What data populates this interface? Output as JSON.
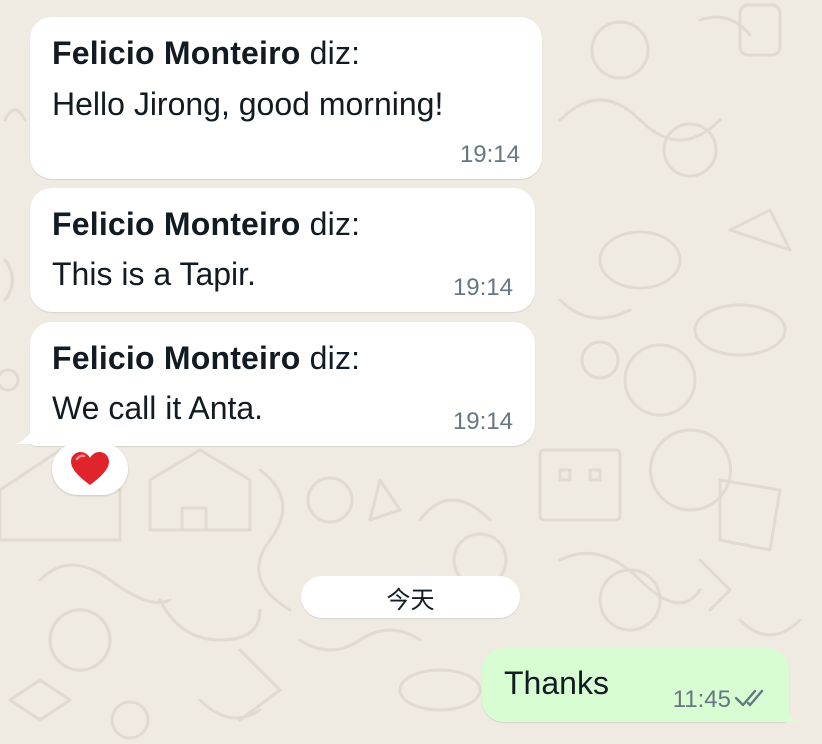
{
  "colors": {
    "background": "#EFEAE2",
    "incoming_bubble": "#FFFFFF",
    "outgoing_bubble": "#D9FDD3",
    "text": "#111B21",
    "meta_text": "#667781"
  },
  "messages": [
    {
      "direction": "incoming",
      "sender": "Felicio Monteiro",
      "sender_suffix": " diz:",
      "text": "Hello Jirong, good morning!",
      "time": "19:14"
    },
    {
      "direction": "incoming",
      "sender": "Felicio Monteiro",
      "sender_suffix": " diz:",
      "text": "This is a Tapir.",
      "time": "19:14"
    },
    {
      "direction": "incoming",
      "sender": "Felicio Monteiro",
      "sender_suffix": " diz:",
      "text": "We call it Anta.",
      "time": "19:14",
      "reaction": "heart-icon"
    }
  ],
  "day_separator": "今天",
  "outgoing": {
    "text": "Thanks",
    "time": "11:45",
    "status": "read",
    "status_icon": "double-check-icon"
  }
}
